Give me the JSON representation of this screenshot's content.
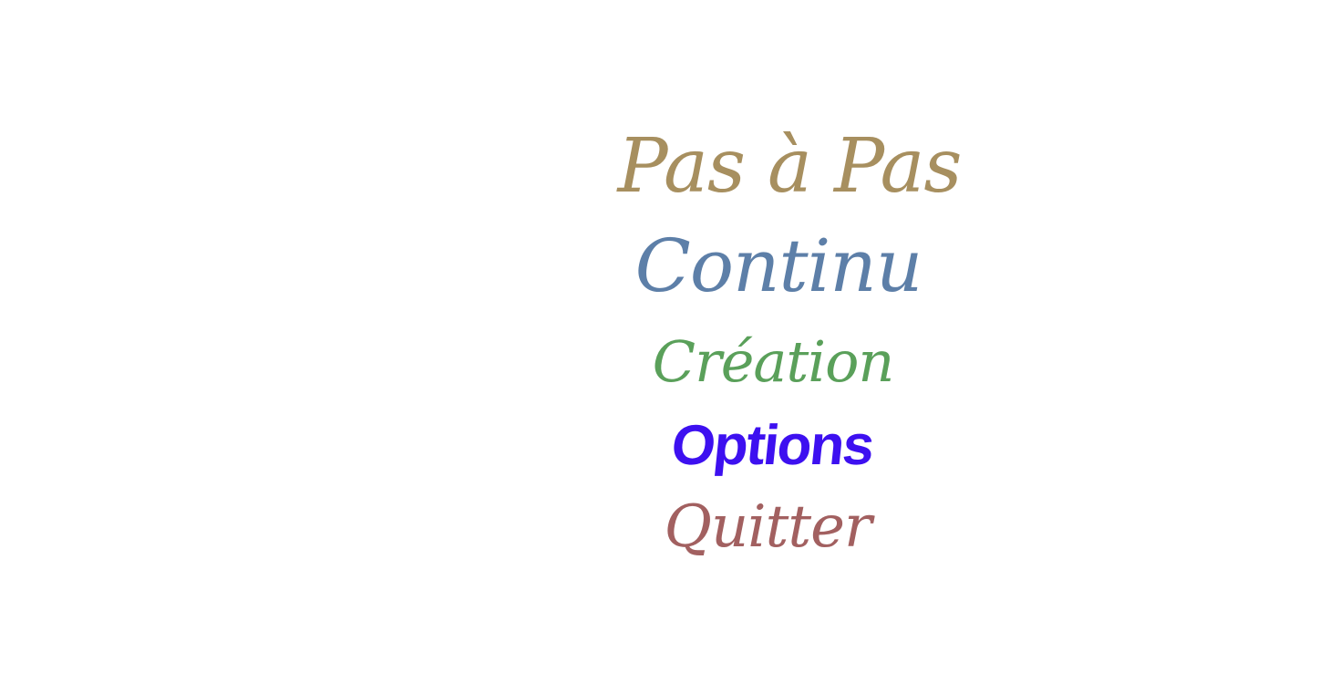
{
  "main_menu": {
    "items": [
      {
        "id": "pas",
        "label": "Pas à Pas",
        "color": "#a78f5f"
      },
      {
        "id": "continu",
        "label": "Continu",
        "color": "#5d7fa8"
      },
      {
        "id": "creation",
        "label": "Création",
        "color": "#5aa05a"
      },
      {
        "id": "options",
        "label": "Options",
        "color": "#3d10f0"
      },
      {
        "id": "quitter",
        "label": "Quitter",
        "color": "#a26060"
      }
    ]
  }
}
